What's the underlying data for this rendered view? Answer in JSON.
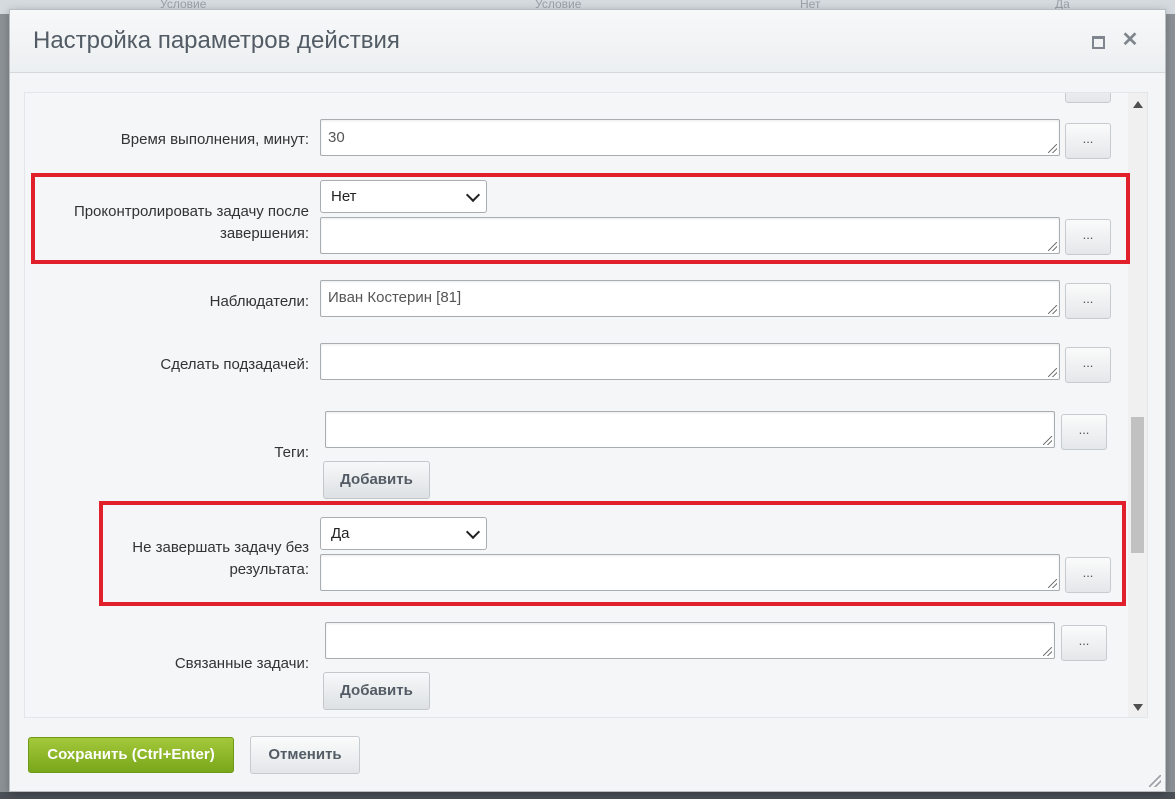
{
  "background": {
    "header_cells": [
      "Условие",
      "Условие",
      "Нет",
      "Да"
    ]
  },
  "dialog": {
    "title": "Настройка параметров действия"
  },
  "form": {
    "duration": {
      "label": "Время выполнения, минут:",
      "value": "30",
      "button": "..."
    },
    "control": {
      "label_line1": "Проконтролировать задачу после",
      "label_line2": "завершения:",
      "select_value": "Нет",
      "value": "",
      "button": "..."
    },
    "observers": {
      "label": "Наблюдатели:",
      "value": "Иван Костерин [81]",
      "button": "..."
    },
    "subtask": {
      "label": "Сделать подзадачей:",
      "value": "",
      "button": "..."
    },
    "tags": {
      "label": "Теги:",
      "value": "",
      "button": "...",
      "add_label": "Добавить"
    },
    "no_complete": {
      "label_line1": "Не завершать задачу без",
      "label_line2": "результата:",
      "select_value": "Да",
      "value": "",
      "button": "..."
    },
    "related": {
      "label": "Связанные задачи:",
      "value": "",
      "button": "...",
      "add_label": "Добавить"
    }
  },
  "footer": {
    "save_label": "Сохранить (Ctrl+Enter)",
    "cancel_label": "Отменить"
  },
  "colors": {
    "highlight": "#e0202a",
    "save_button": "#8ab52a"
  }
}
